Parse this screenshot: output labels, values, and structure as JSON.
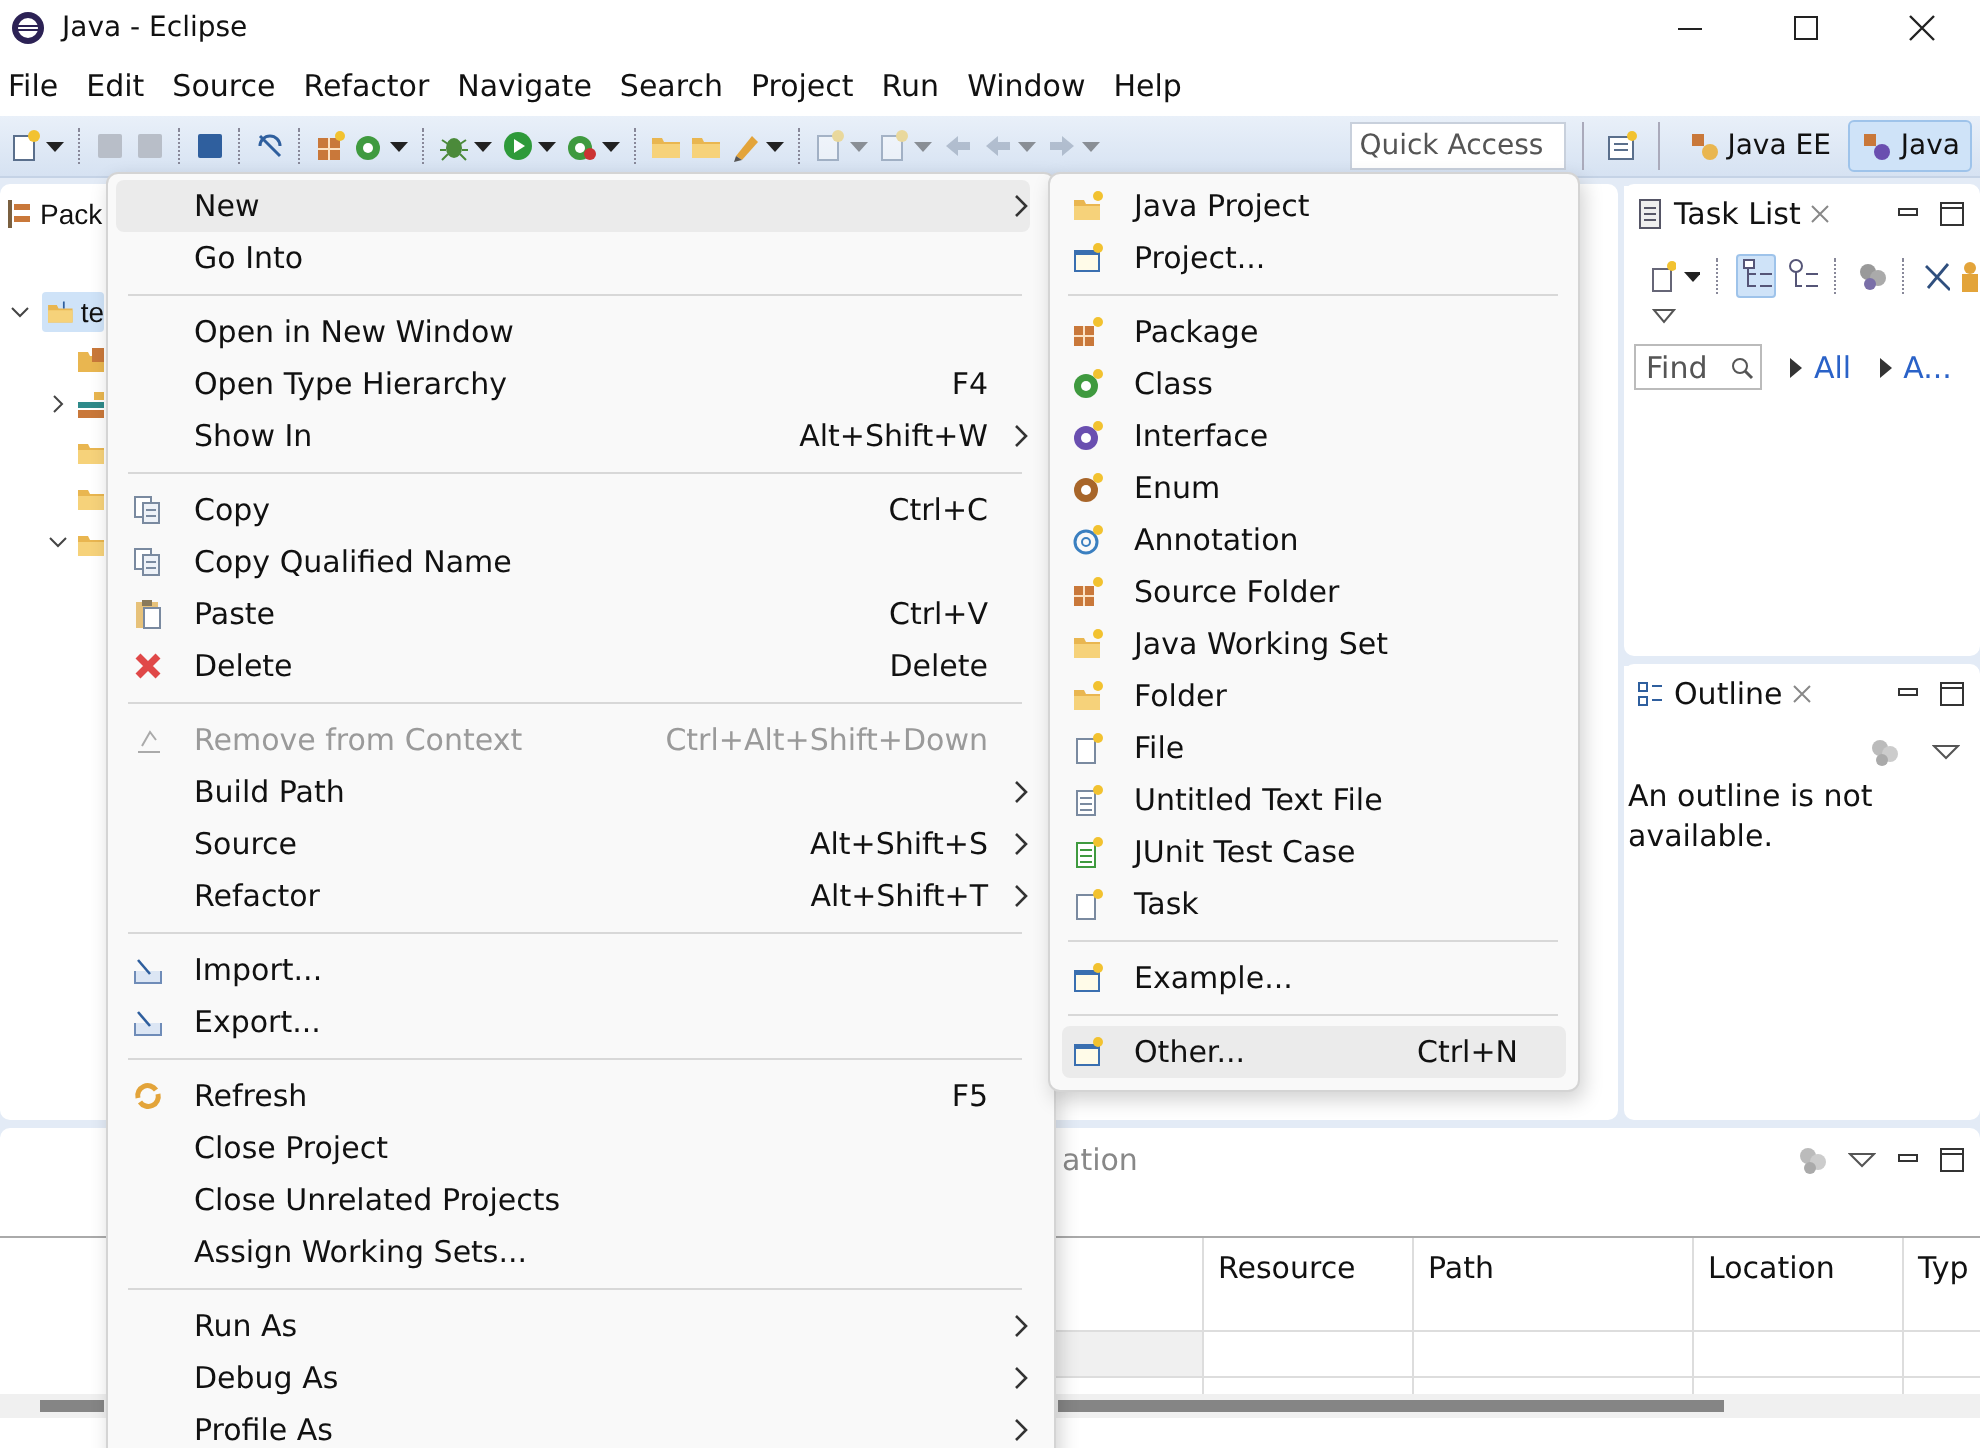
{
  "window": {
    "title": "Java - Eclipse"
  },
  "menu_bar": [
    "File",
    "Edit",
    "Source",
    "Refactor",
    "Navigate",
    "Search",
    "Project",
    "Run",
    "Window",
    "Help"
  ],
  "toolbar": {
    "quick_access": {
      "placeholder": "Quick Access"
    },
    "perspectives": [
      {
        "label": "Java EE",
        "selected": false
      },
      {
        "label": "Java",
        "selected": true
      }
    ]
  },
  "package_explorer": {
    "title": "Pack",
    "tree": [
      {
        "label": "te",
        "selected": true,
        "expanded": true,
        "children": [
          {
            "kind": "source-folder"
          },
          {
            "kind": "library",
            "expanded": false
          },
          {
            "kind": "folder"
          },
          {
            "kind": "folder"
          },
          {
            "kind": "folder",
            "expanded": true
          }
        ]
      }
    ]
  },
  "context_menu": {
    "items": [
      {
        "kind": "item",
        "label": "New",
        "submenu": true,
        "selected": true,
        "disabled": false
      },
      {
        "kind": "item",
        "label": "Go Into",
        "selected": false,
        "disabled": false
      },
      {
        "kind": "separator"
      },
      {
        "kind": "item",
        "label": "Open in New Window",
        "selected": false,
        "disabled": false
      },
      {
        "kind": "item",
        "label": "Open Type Hierarchy",
        "shortcut": "F4",
        "selected": false,
        "disabled": false
      },
      {
        "kind": "item",
        "label": "Show In",
        "shortcut": "Alt+Shift+W",
        "submenu": true,
        "selected": false,
        "disabled": false
      },
      {
        "kind": "separator"
      },
      {
        "kind": "item",
        "label": "Copy",
        "shortcut": "Ctrl+C",
        "selected": false,
        "disabled": false
      },
      {
        "kind": "item",
        "label": "Copy Qualified Name",
        "selected": false,
        "disabled": false
      },
      {
        "kind": "item",
        "label": "Paste",
        "shortcut": "Ctrl+V",
        "selected": false,
        "disabled": false
      },
      {
        "kind": "item",
        "label": "Delete",
        "shortcut": "Delete",
        "selected": false,
        "disabled": false
      },
      {
        "kind": "separator"
      },
      {
        "kind": "item",
        "label": "Remove from Context",
        "shortcut": "Ctrl+Alt+Shift+Down",
        "selected": false,
        "disabled": true
      },
      {
        "kind": "item",
        "label": "Build Path",
        "submenu": true,
        "selected": false,
        "disabled": false
      },
      {
        "kind": "item",
        "label": "Source",
        "shortcut": "Alt+Shift+S",
        "submenu": true,
        "selected": false,
        "disabled": false
      },
      {
        "kind": "item",
        "label": "Refactor",
        "shortcut": "Alt+Shift+T",
        "submenu": true,
        "selected": false,
        "disabled": false
      },
      {
        "kind": "separator"
      },
      {
        "kind": "item",
        "label": "Import...",
        "selected": false,
        "disabled": false
      },
      {
        "kind": "item",
        "label": "Export...",
        "selected": false,
        "disabled": false
      },
      {
        "kind": "separator"
      },
      {
        "kind": "item",
        "label": "Refresh",
        "shortcut": "F5",
        "selected": false,
        "disabled": false
      },
      {
        "kind": "item",
        "label": "Close Project",
        "selected": false,
        "disabled": false
      },
      {
        "kind": "item",
        "label": "Close Unrelated Projects",
        "selected": false,
        "disabled": false
      },
      {
        "kind": "item",
        "label": "Assign Working Sets...",
        "selected": false,
        "disabled": false
      },
      {
        "kind": "separator"
      },
      {
        "kind": "item",
        "label": "Run As",
        "submenu": true,
        "selected": false,
        "disabled": false
      },
      {
        "kind": "item",
        "label": "Debug As",
        "submenu": true,
        "selected": false,
        "disabled": false
      },
      {
        "kind": "item",
        "label": "Profile As",
        "submenu": true,
        "selected": false,
        "disabled": false
      }
    ]
  },
  "new_submenu": {
    "items": [
      {
        "kind": "item",
        "label": "Java Project",
        "selected": false
      },
      {
        "kind": "item",
        "label": "Project...",
        "selected": false
      },
      {
        "kind": "separator"
      },
      {
        "kind": "item",
        "label": "Package",
        "selected": false
      },
      {
        "kind": "item",
        "label": "Class",
        "selected": false
      },
      {
        "kind": "item",
        "label": "Interface",
        "selected": false
      },
      {
        "kind": "item",
        "label": "Enum",
        "selected": false
      },
      {
        "kind": "item",
        "label": "Annotation",
        "selected": false
      },
      {
        "kind": "item",
        "label": "Source Folder",
        "selected": false
      },
      {
        "kind": "item",
        "label": "Java Working Set",
        "selected": false
      },
      {
        "kind": "item",
        "label": "Folder",
        "selected": false
      },
      {
        "kind": "item",
        "label": "File",
        "selected": false
      },
      {
        "kind": "item",
        "label": "Untitled Text File",
        "selected": false
      },
      {
        "kind": "item",
        "label": "JUnit Test Case",
        "selected": false
      },
      {
        "kind": "item",
        "label": "Task",
        "selected": false
      },
      {
        "kind": "separator"
      },
      {
        "kind": "item",
        "label": "Example...",
        "selected": false
      },
      {
        "kind": "separator"
      },
      {
        "kind": "item",
        "label": "Other...",
        "shortcut": "Ctrl+N",
        "selected": true
      }
    ]
  },
  "task_list": {
    "title": "Task List",
    "find": {
      "placeholder": "Find"
    },
    "filters": [
      "All",
      "A..."
    ]
  },
  "outline": {
    "title": "Outline",
    "message": "An outline is not available."
  },
  "bottom_panel": {
    "tab_label": "ation",
    "columns": [
      "Resource",
      "Path",
      "Location",
      "Typ"
    ]
  }
}
